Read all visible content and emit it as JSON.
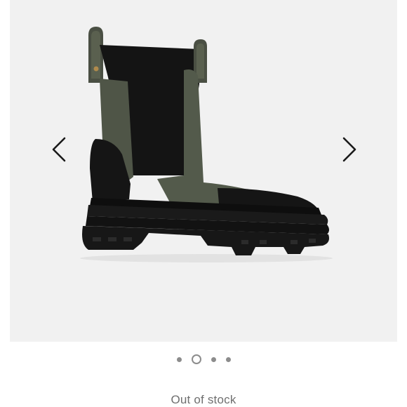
{
  "gallery": {
    "image_alt": "product-boot-image",
    "prev_icon": "chevron-left-icon",
    "next_icon": "chevron-right-icon",
    "slides_count": 4,
    "active_slide": 2
  },
  "product": {
    "stock_status": "Out of stock"
  },
  "colors": {
    "gallery_bg": "#f1f1f1",
    "boot_upper": "#4f5547",
    "boot_black": "#161616",
    "text_muted": "#6f6f6f"
  }
}
